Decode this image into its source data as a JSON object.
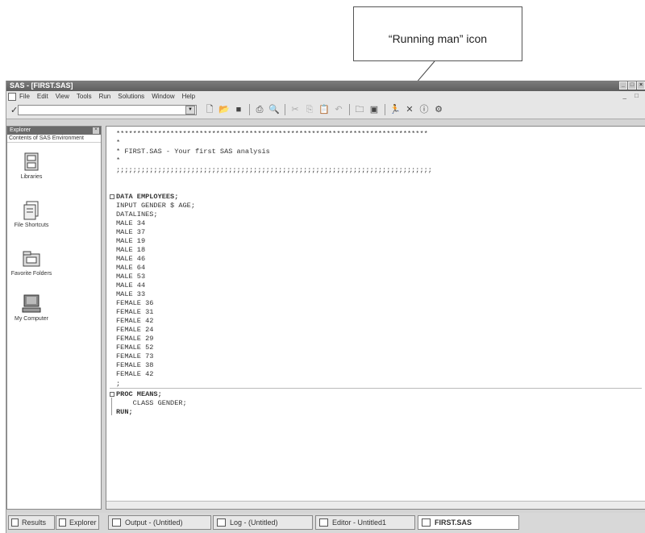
{
  "annotation": {
    "text": "“Running man” icon"
  },
  "window": {
    "title": "SAS - [FIRST.SAS]"
  },
  "menu": [
    "File",
    "Edit",
    "View",
    "Tools",
    "Run",
    "Solutions",
    "Window",
    "Help"
  ],
  "toolbar": {
    "command_value": "",
    "icons": [
      "new-icon",
      "open-icon",
      "save-icon",
      "print-icon",
      "print-preview-icon",
      "cut-icon",
      "copy-icon",
      "paste-icon",
      "undo-icon",
      "libraries-icon",
      "explorer-icon",
      "submit-running-man-icon",
      "break-icon",
      "help-icon",
      "options-icon"
    ]
  },
  "explorer": {
    "title": "Explorer",
    "subtitle": "Contents of SAS Environment",
    "items": [
      {
        "label": "Libraries",
        "icon": "cabinet-icon"
      },
      {
        "label": "File Shortcuts",
        "icon": "file-shortcut-icon"
      },
      {
        "label": "Favorite Folders",
        "icon": "favorite-folder-icon"
      },
      {
        "label": "My Computer",
        "icon": "computer-icon"
      }
    ]
  },
  "editor": {
    "lines": [
      "***************************************************************************",
      "*",
      "* FIRST.SAS - Your first SAS analysis",
      "*",
      ";;;;;;;;;;;;;;;;;;;;;;;;;;;;;;;;;;;;;;;;;;;;;;;;;;;;;;;;;;;;;;;;;;;;;;;;;;;;",
      "",
      "DATA EMPLOYEES;",
      "INPUT GENDER $ AGE;",
      "DATALINES;",
      "MALE 34",
      "MALE 37",
      "MALE 19",
      "MALE 18",
      "MALE 46",
      "MALE 64",
      "MALE 53",
      "MALE 44",
      "MALE 33",
      "FEMALE 36",
      "FEMALE 31",
      "FEMALE 42",
      "FEMALE 24",
      "FEMALE 29",
      "FEMALE 52",
      "FEMALE 73",
      "FEMALE 38",
      "FEMALE 42",
      ";",
      "PROC MEANS;",
      "    CLASS GENDER;",
      "RUN;"
    ]
  },
  "bottom_tabs": {
    "left": [
      {
        "label": "Results"
      },
      {
        "label": "Explorer"
      }
    ],
    "windows": [
      {
        "label": "Output - (Untitled)"
      },
      {
        "label": "Log - (Untitled)"
      },
      {
        "label": "Editor - Untitled1"
      },
      {
        "label": "FIRST.SAS"
      }
    ]
  }
}
